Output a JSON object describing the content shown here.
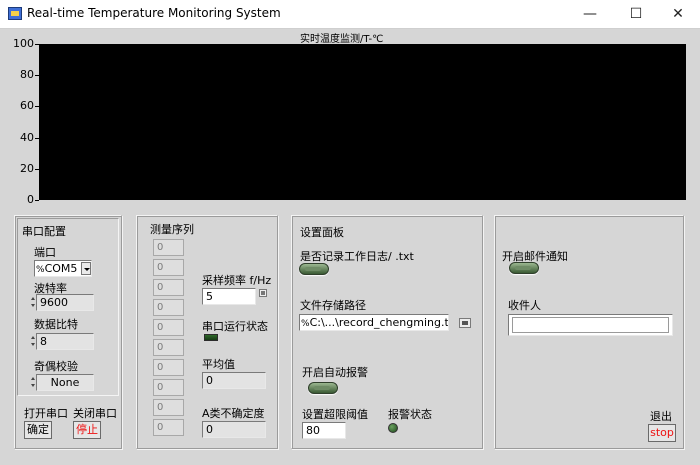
{
  "window": {
    "title": "Real-time Temperature Monitoring System",
    "minimize_glyph": "—",
    "maximize_glyph": "☐",
    "close_glyph": "✕"
  },
  "chart": {
    "title": "实时温度监测/T-℃",
    "ticks": [
      "100",
      "80",
      "60",
      "40",
      "20",
      "0"
    ]
  },
  "chart_data": {
    "type": "line",
    "title": "实时温度监测/T-℃",
    "xlabel": "",
    "ylabel": "",
    "ylim": [
      0,
      100
    ],
    "yticks": [
      0,
      20,
      40,
      60,
      80,
      100
    ],
    "series": [],
    "background": "#000000"
  },
  "serial": {
    "heading": "串口配置",
    "port_label": "端口",
    "port_prefix": "%",
    "port_value": "COM5",
    "baud_label": "波特率",
    "baud_value": "9600",
    "databits_label": "数据比特",
    "databits_value": "8",
    "parity_label": "奇偶校验",
    "parity_value": "None",
    "open_label": "打开串口",
    "close_label": "关闭串口",
    "confirm_button": "确定",
    "stop_button": "停止"
  },
  "measurement": {
    "heading": "测量序列",
    "sequence": [
      "0",
      "0",
      "0",
      "0",
      "0",
      "0",
      "0",
      "0",
      "0",
      "0"
    ],
    "rate_label": "采样频率 f/Hz",
    "rate_value": "5",
    "serial_status_label": "串口运行状态",
    "mean_label": "平均值",
    "mean_value": "0",
    "uncertainty_label": "A类不确定度",
    "uncertainty_value": "0"
  },
  "settings": {
    "heading": "设置面板",
    "log_label": "是否记录工作日志/ .txt",
    "path_label": "文件存储路径",
    "path_prefix": "%",
    "path_value": "C:\\...\\record_chengming.txt",
    "alarm_label": "开启自动报警",
    "threshold_label": "设置超限阈值",
    "threshold_value": "80",
    "alarm_status_label": "报警状态"
  },
  "mail": {
    "enable_label": "开启邮件通知",
    "recipient_label": "收件人",
    "recipient_value": "",
    "exit_label": "退出",
    "stop_button": "stop"
  }
}
